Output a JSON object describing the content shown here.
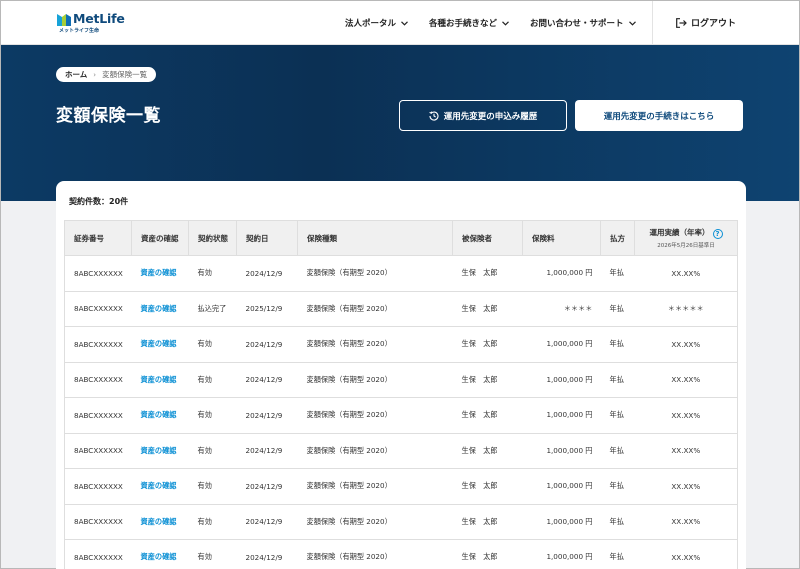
{
  "header": {
    "logo_text": "MetLife",
    "logo_sub": "メットライフ生命",
    "nav": [
      "法人ポータル",
      "各種お手続きなど",
      "お問い合わせ・サポート"
    ],
    "logout": "ログアウト"
  },
  "breadcrumb": {
    "home": "ホーム",
    "current": "変額保険一覧"
  },
  "page_title": "変額保険一覧",
  "buttons": {
    "history": "運用先変更の申込み履歴",
    "procedure": "運用先変更の手続きはこちら"
  },
  "count": "契約件数：20件",
  "table": {
    "headers": [
      "証券番号",
      "資産の確認",
      "契約状態",
      "契約日",
      "保険種類",
      "被保険者",
      "保険料",
      "払方",
      "運用実績（年率）"
    ],
    "perf_sub": "2026年5月26日基準日",
    "help": "?",
    "rows": [
      {
        "policy": "8ABCXXXXXX",
        "asset": "資産の確認",
        "status": "有効",
        "date": "2024/12/9",
        "type": "変額保険（有期型 2020）",
        "insured": "生保　太郎",
        "premium": "1,000,000 円",
        "payment": "年払",
        "perf": "XX.XX%"
      },
      {
        "policy": "8ABCXXXXXX",
        "asset": "資産の確認",
        "status": "払込完了",
        "date": "2025/12/9",
        "type": "変額保険（有期型 2020）",
        "insured": "生保　太郎",
        "premium": "＊＊＊＊",
        "payment": "年払",
        "perf": "＊＊＊＊＊"
      },
      {
        "policy": "8ABCXXXXXX",
        "asset": "資産の確認",
        "status": "有効",
        "date": "2024/12/9",
        "type": "変額保険（有期型 2020）",
        "insured": "生保　太郎",
        "premium": "1,000,000 円",
        "payment": "年払",
        "perf": "XX.XX%"
      },
      {
        "policy": "8ABCXXXXXX",
        "asset": "資産の確認",
        "status": "有効",
        "date": "2024/12/9",
        "type": "変額保険（有期型 2020）",
        "insured": "生保　太郎",
        "premium": "1,000,000 円",
        "payment": "年払",
        "perf": "XX.XX%"
      },
      {
        "policy": "8ABCXXXXXX",
        "asset": "資産の確認",
        "status": "有効",
        "date": "2024/12/9",
        "type": "変額保険（有期型 2020）",
        "insured": "生保　太郎",
        "premium": "1,000,000 円",
        "payment": "年払",
        "perf": "XX.XX%"
      },
      {
        "policy": "8ABCXXXXXX",
        "asset": "資産の確認",
        "status": "有効",
        "date": "2024/12/9",
        "type": "変額保険（有期型 2020）",
        "insured": "生保　太郎",
        "premium": "1,000,000 円",
        "payment": "年払",
        "perf": "XX.XX%"
      },
      {
        "policy": "8ABCXXXXXX",
        "asset": "資産の確認",
        "status": "有効",
        "date": "2024/12/9",
        "type": "変額保険（有期型 2020）",
        "insured": "生保　太郎",
        "premium": "1,000,000 円",
        "payment": "年払",
        "perf": "XX.XX%"
      },
      {
        "policy": "8ABCXXXXXX",
        "asset": "資産の確認",
        "status": "有効",
        "date": "2024/12/9",
        "type": "変額保険（有期型 2020）",
        "insured": "生保　太郎",
        "premium": "1,000,000 円",
        "payment": "年払",
        "perf": "XX.XX%"
      },
      {
        "policy": "8ABCXXXXXX",
        "asset": "資産の確認",
        "status": "有効",
        "date": "2024/12/9",
        "type": "変額保険（有期型 2020）",
        "insured": "生保　太郎",
        "premium": "1,000,000 円",
        "payment": "年払",
        "perf": "XX.XX%"
      }
    ]
  },
  "colors": {
    "brand": "#0f4a7c",
    "link": "#0a8fd4",
    "hero_dark": "#0b3054"
  }
}
